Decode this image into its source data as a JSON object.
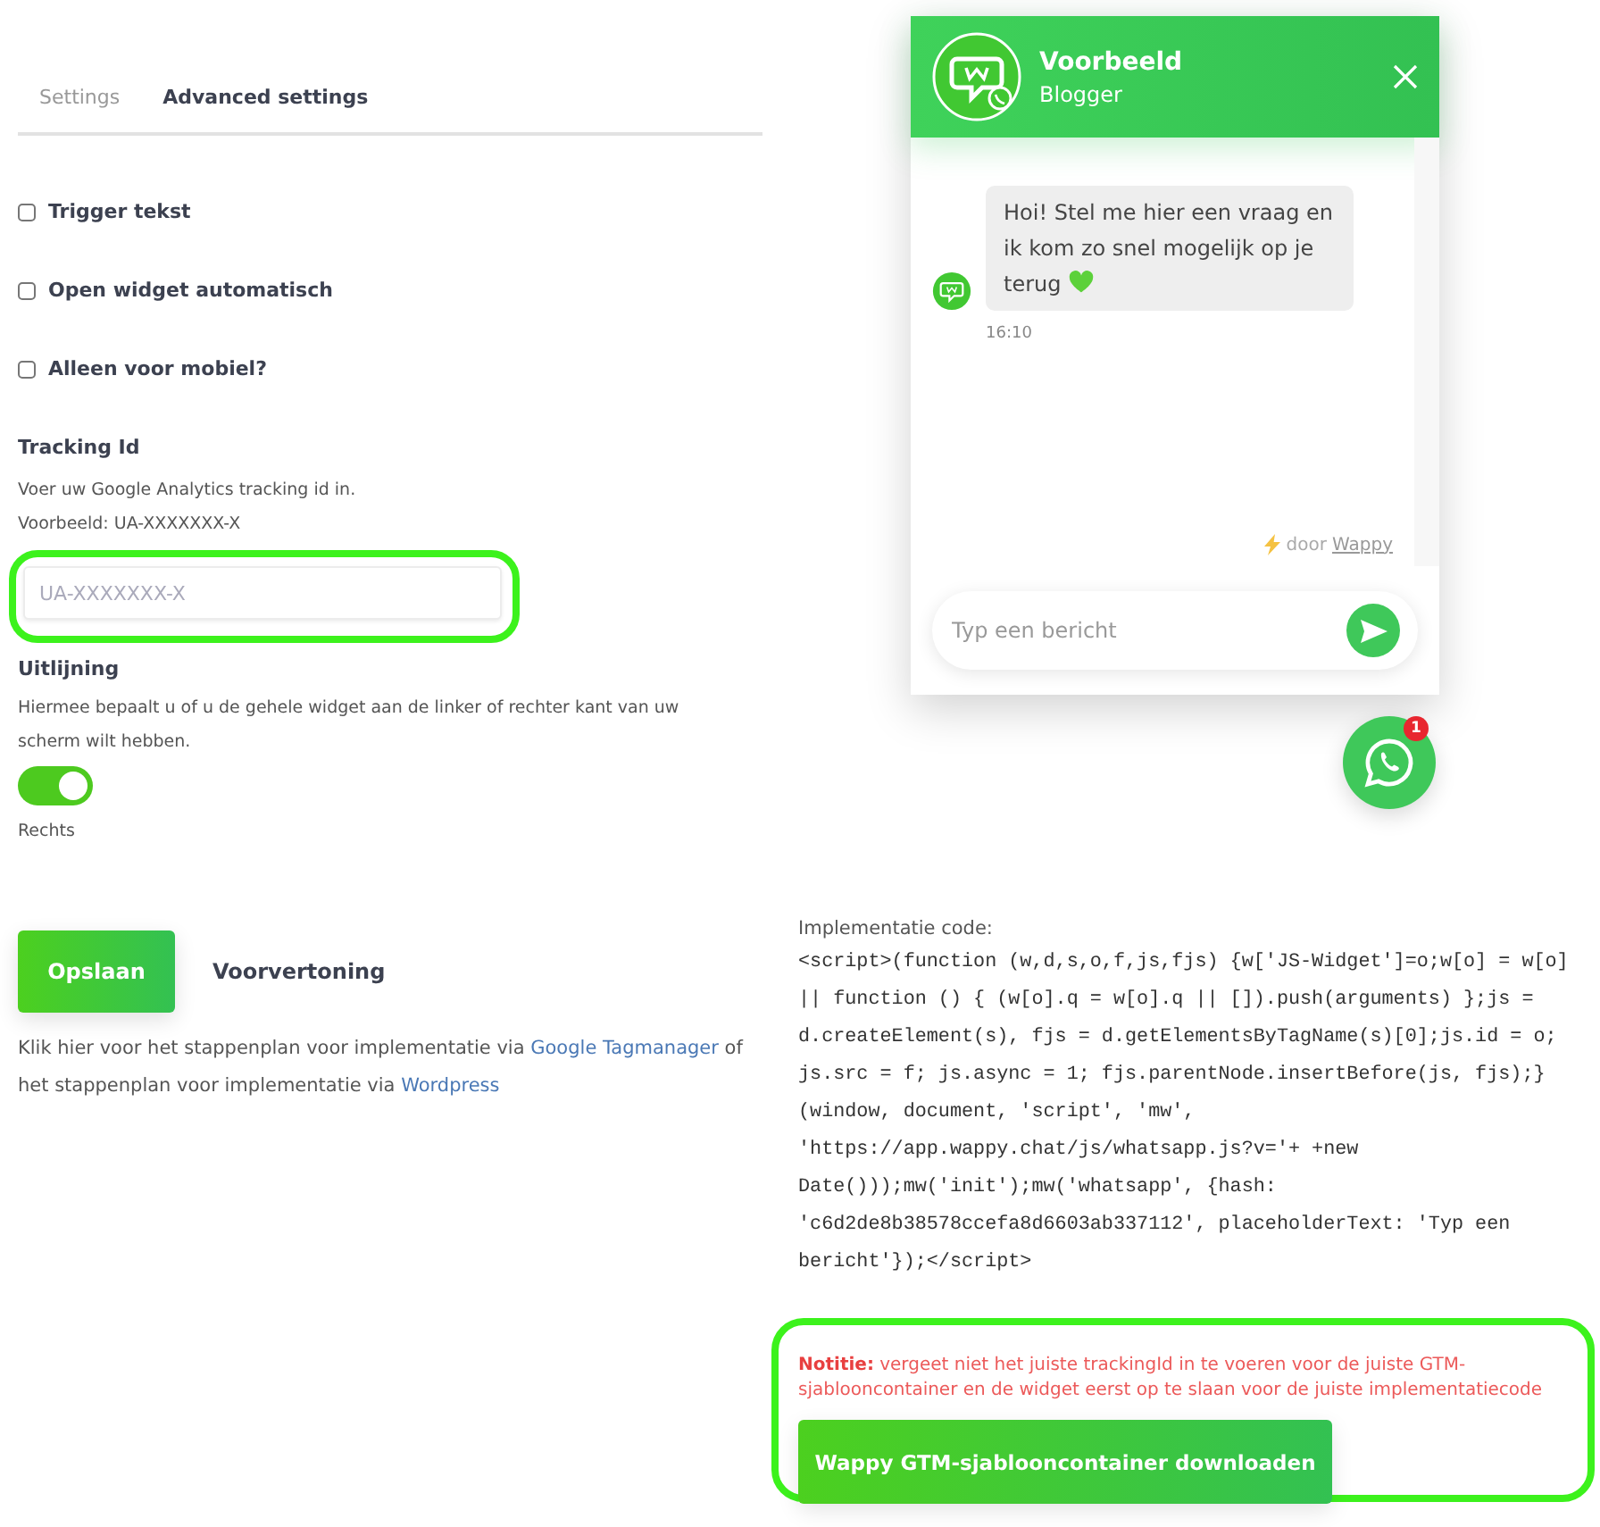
{
  "tabs": [
    {
      "label": "Settings",
      "selected": false
    },
    {
      "label": "Advanced settings",
      "selected": true
    }
  ],
  "options": [
    {
      "label": "Trigger tekst",
      "checked": false
    },
    {
      "label": "Open widget automatisch",
      "checked": false
    },
    {
      "label": "Alleen voor mobiel?",
      "checked": false
    }
  ],
  "tracking": {
    "heading": "Tracking Id",
    "help": [
      "Voer uw Google Analytics tracking id in.",
      "Voorbeeld: UA-XXXXXXX-X"
    ],
    "placeholder": "UA-XXXXXXX-X"
  },
  "alignment": {
    "heading": "Uitlijning",
    "help": "Hiermee bepaalt u of u de gehele widget aan de linker of rechter kant van uw scherm wilt hebben.",
    "on": true,
    "value": "Rechts"
  },
  "actions": {
    "save": "Opslaan",
    "preview": "Voorvertoning"
  },
  "instructions": [
    {
      "kind": "text",
      "text": "Klik hier voor het stappenplan voor implementatie via "
    },
    {
      "kind": "link",
      "text": "Google Tagmanager"
    },
    {
      "kind": "text",
      "text": " of het stappenplan voor implementatie via "
    },
    {
      "kind": "link",
      "text": "Wordpress"
    }
  ],
  "chat": {
    "name": "Voorbeeld",
    "role": "Blogger",
    "message": "Hoi! Stel me hier een vraag en ik kom zo snel mogelijk op je terug",
    "time": "16:10",
    "credit": "door",
    "credit_link": "Wappy",
    "placeholder": "Typ een bericht"
  },
  "fab": {
    "badge": "1"
  },
  "implementation": {
    "label": "Implementatie code:",
    "code_lines": [
      "<script>(function (w,d,s,o,f,js,fjs) {w['JS-Widget']=o;w[o] = w[o]",
      "|| function () { (w[o].q = w[o].q || []).push(arguments) };js =",
      "d.createElement(s), fjs = d.getElementsByTagName(s)[0];js.id = o;",
      "js.src = f; js.async = 1; fjs.parentNode.insertBefore(js, fjs);}",
      "(window, document, 'script', 'mw',",
      "'https://app.wappy.chat/js/whatsapp.js?v='+ +new",
      "Date()));mw('init');mw('whatsapp', {hash:",
      "'c6d2de8b38578ccefa8d6603ab337112', placeholderText: 'Typ een",
      "bericht'});</script>"
    ],
    "note": "**Notitie:** vergeet niet het juiste trackingId in te voeren voor de juiste GTM-sjablooncontainer en de widget eerst op te slaan voor de juiste implementatiecode",
    "download": "Wappy GTM-sjablooncontainer downloaden"
  }
}
